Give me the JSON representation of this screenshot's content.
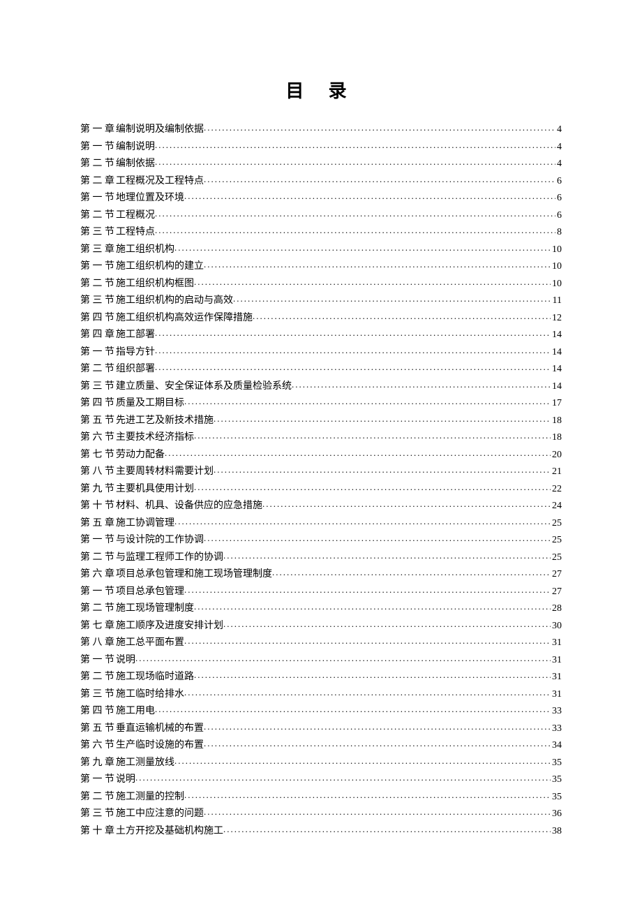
{
  "title": "目 录",
  "toc": [
    {
      "label": "第 一 章",
      "title": "编制说明及编制依据",
      "page": "4"
    },
    {
      "label": "第 一 节",
      "title": "编制说明",
      "page": "4"
    },
    {
      "label": "第 二 节",
      "title": "编制依据",
      "page": "4"
    },
    {
      "label": "第 二 章",
      "title": "工程概况及工程特点",
      "page": "6"
    },
    {
      "label": "第 一 节",
      "title": "地理位置及环境",
      "page": "6"
    },
    {
      "label": "第 二 节",
      "title": "工程概况",
      "page": "6"
    },
    {
      "label": "第 三 节",
      "title": "工程特点",
      "page": "8"
    },
    {
      "label": "第 三 章",
      "title": "施工组织机构",
      "page": "10"
    },
    {
      "label": "第 一 节",
      "title": "施工组织机构的建立",
      "page": "10"
    },
    {
      "label": "第 二 节",
      "title": "施工组织机构框图",
      "page": "10"
    },
    {
      "label": "第 三 节",
      "title": "施工组织机构的启动与高效",
      "page": "11"
    },
    {
      "label": "第 四 节",
      "title": "施工组织机构高效运作保障措施",
      "page": "12"
    },
    {
      "label": "第 四 章",
      "title": "施工部署",
      "page": "14"
    },
    {
      "label": "第 一 节",
      "title": "指导方针",
      "page": "14"
    },
    {
      "label": "第 二 节",
      "title": "组织部署",
      "page": "14"
    },
    {
      "label": "第 三 节",
      "title": "建立质量、安全保证体系及质量检验系统",
      "page": "14"
    },
    {
      "label": "第 四 节",
      "title": "质量及工期目标",
      "page": "17"
    },
    {
      "label": "第 五 节",
      "title": "先进工艺及新技术措施",
      "page": "18"
    },
    {
      "label": "第 六 节",
      "title": "主要技术经济指标",
      "page": "18"
    },
    {
      "label": "第 七 节",
      "title": "劳动力配备",
      "page": "20"
    },
    {
      "label": "第 八 节",
      "title": "主要周转材料需要计划",
      "page": "21"
    },
    {
      "label": "第 九 节",
      "title": "主要机具使用计划",
      "page": "22"
    },
    {
      "label": "第 十 节",
      "title": "材料、机具、设备供应的应急措施",
      "page": "24"
    },
    {
      "label": "第 五 章",
      "title": "施工协调管理",
      "page": "25"
    },
    {
      "label": "第 一 节",
      "title": "与设计院的工作协调",
      "page": "25"
    },
    {
      "label": "第 二 节",
      "title": "与监理工程师工作的协调",
      "page": "25"
    },
    {
      "label": "第 六 章",
      "title": "项目总承包管理和施工现场管理制度",
      "page": "27"
    },
    {
      "label": "第 一 节",
      "title": "项目总承包管理",
      "page": "27"
    },
    {
      "label": "第 二 节",
      "title": "施工现场管理制度",
      "page": "28"
    },
    {
      "label": "第 七 章",
      "title": "施工顺序及进度安排计划",
      "page": "30"
    },
    {
      "label": "第 八 章",
      "title": "施工总平面布置",
      "page": "31"
    },
    {
      "label": "第 一 节",
      "title": "说明",
      "page": "31"
    },
    {
      "label": "第 二 节",
      "title": "施工现场临时道路",
      "page": "31"
    },
    {
      "label": "第 三 节",
      "title": "施工临时给排水",
      "page": "31"
    },
    {
      "label": "第 四 节",
      "title": "施工用电",
      "page": "33"
    },
    {
      "label": "第 五 节",
      "title": "垂直运输机械的布置",
      "page": "33"
    },
    {
      "label": "第 六 节",
      "title": "生产临时设施的布置",
      "page": "34"
    },
    {
      "label": "第 九 章",
      "title": "施工测量放线",
      "page": "35"
    },
    {
      "label": "第 一 节",
      "title": "说明",
      "page": "35"
    },
    {
      "label": "第 二 节",
      "title": "施工测量的控制",
      "page": "35"
    },
    {
      "label": "第 三 节",
      "title": "施工中应注意的问题",
      "page": "36"
    },
    {
      "label": "第 十 章",
      "title": "土方开挖及基础机构施工",
      "page": "38"
    }
  ]
}
